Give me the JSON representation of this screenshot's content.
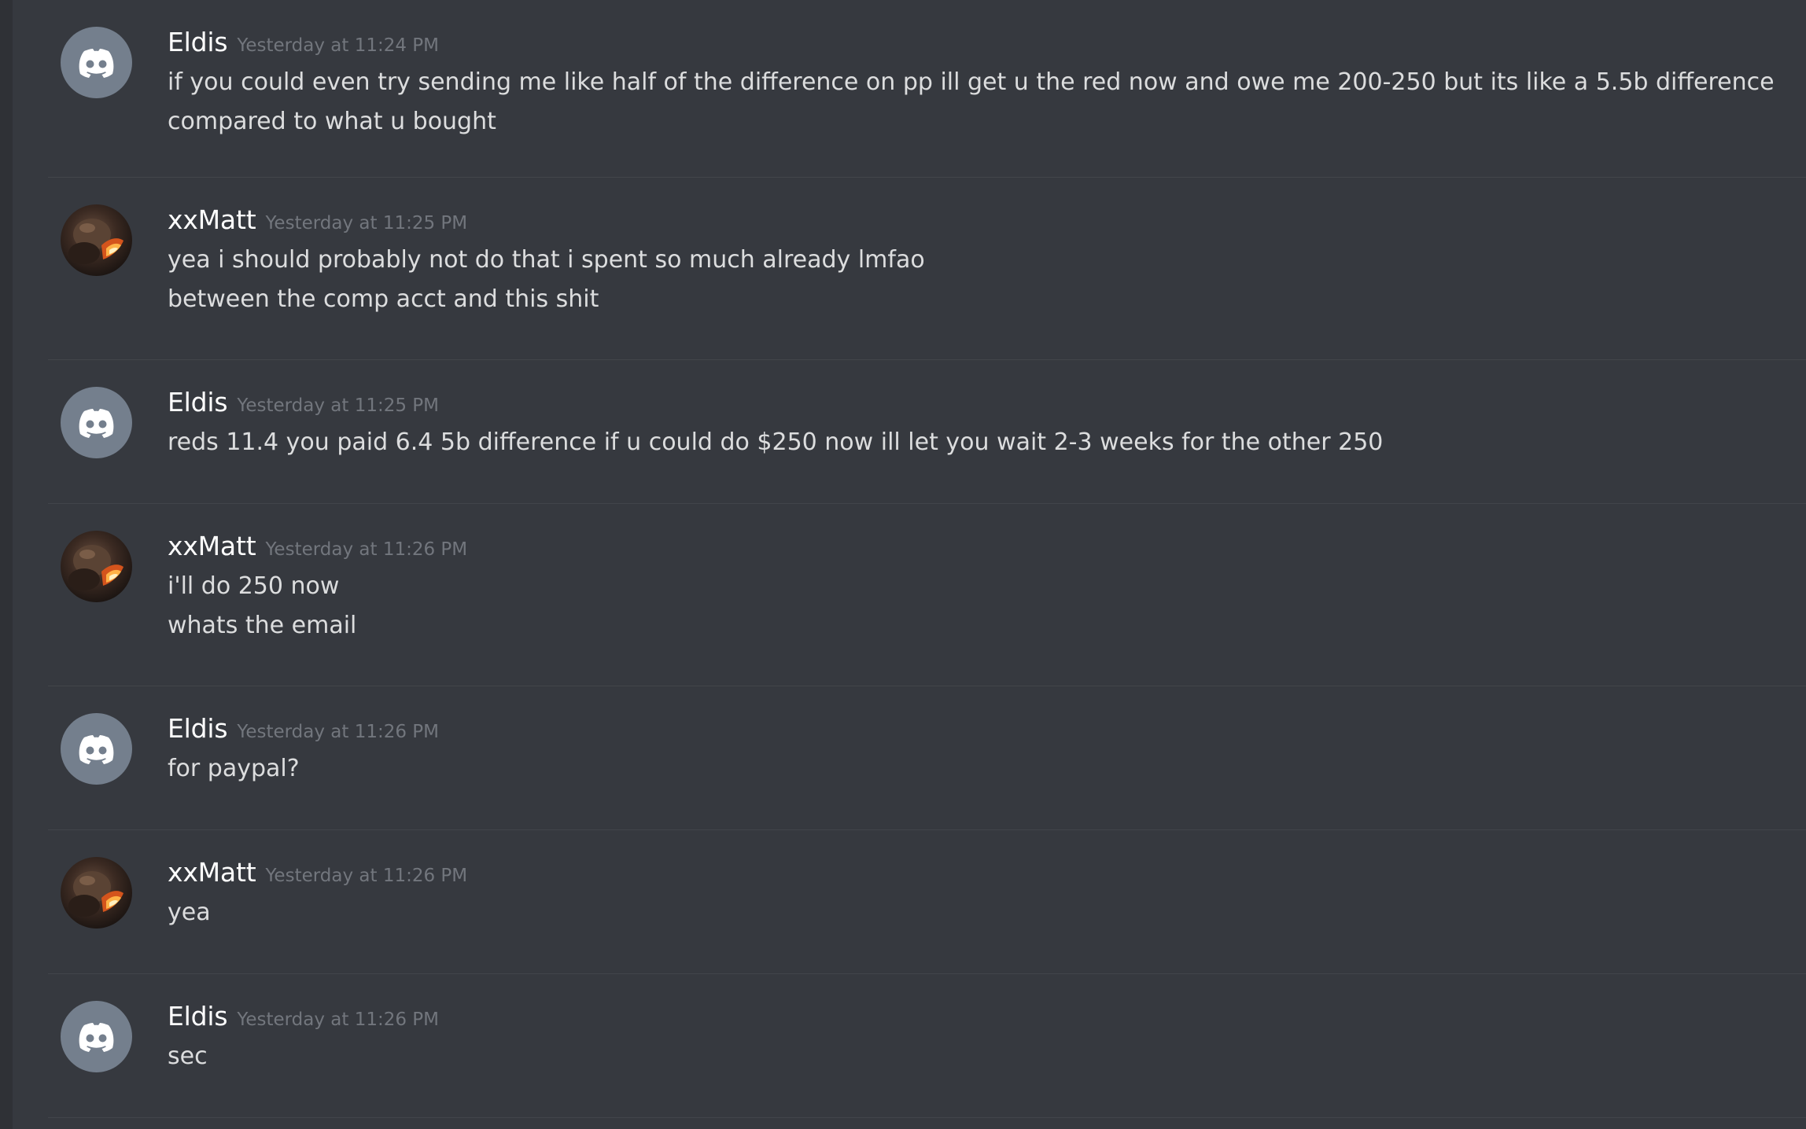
{
  "messages": [
    {
      "author": "Eldis",
      "avatar": "discord-default-avatar",
      "timestamp": "Yesterday at 11:24 PM",
      "lines": [
        "if you could even try sending me like half of the difference on pp ill get u the red now and owe me 200-250 but its like a 5.5b difference",
        "compared to what u bought"
      ]
    },
    {
      "author": "xxMatt",
      "avatar": "custom-avatar",
      "timestamp": "Yesterday at 11:25 PM",
      "lines": [
        "yea i should probably not do that i spent so much already lmfao",
        "between the comp acct and this shit"
      ]
    },
    {
      "author": "Eldis",
      "avatar": "discord-default-avatar",
      "timestamp": "Yesterday at 11:25 PM",
      "lines": [
        "reds 11.4 you paid 6.4 5b difference if u could do $250 now ill let you wait 2-3 weeks for the other 250"
      ]
    },
    {
      "author": "xxMatt",
      "avatar": "custom-avatar",
      "timestamp": "Yesterday at 11:26 PM",
      "lines": [
        "i'll do 250 now",
        "whats the email"
      ]
    },
    {
      "author": "Eldis",
      "avatar": "discord-default-avatar",
      "timestamp": "Yesterday at 11:26 PM",
      "lines": [
        "for paypal?"
      ]
    },
    {
      "author": "xxMatt",
      "avatar": "custom-avatar",
      "timestamp": "Yesterday at 11:26 PM",
      "lines": [
        "yea"
      ]
    },
    {
      "author": "Eldis",
      "avatar": "discord-default-avatar",
      "timestamp": "Yesterday at 11:26 PM",
      "lines": [
        "sec"
      ]
    }
  ],
  "colors": {
    "background": "#36393f",
    "divider": "#42454a",
    "username": "#ffffff",
    "timestamp": "#72767d",
    "message_text": "#dcddde",
    "default_avatar": "#747f8d"
  }
}
